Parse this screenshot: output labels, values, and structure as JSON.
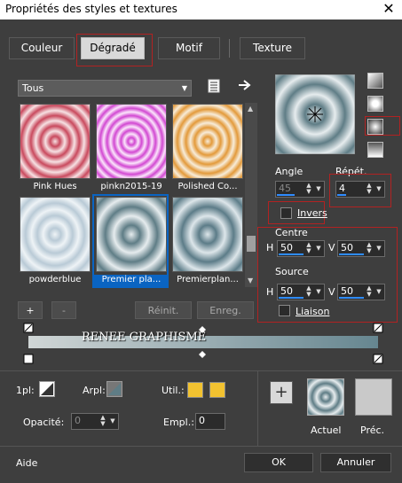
{
  "window": {
    "title": "Propriétés des styles et textures",
    "close_label": "✕"
  },
  "tabs": [
    {
      "label": "Couleur",
      "active": false
    },
    {
      "label": "Dégradé",
      "active": true
    },
    {
      "label": "Motif",
      "active": false
    },
    {
      "label": "Texture",
      "active": false
    }
  ],
  "category_dropdown": {
    "value": "Tous"
  },
  "gradients": [
    {
      "label": "Pink Hues"
    },
    {
      "label": "pinkn2015-19"
    },
    {
      "label": "Polished Co..."
    },
    {
      "label": "powderblue"
    },
    {
      "label": "Premier pla...",
      "selected": true
    },
    {
      "label": "Premierplan..."
    }
  ],
  "list_buttons": {
    "add": "+",
    "remove": "-",
    "reset": "Réinit.",
    "save": "Enreg."
  },
  "gradient_bar": {
    "watermark": "RENEE GRAPHISME"
  },
  "angle": {
    "label": "Angle",
    "value": "45"
  },
  "repeat": {
    "label": "Répét.",
    "value": "4"
  },
  "invert": {
    "label": "Invers",
    "checked": false
  },
  "center": {
    "label": "Centre",
    "h_label": "H",
    "h_value": "50",
    "v_label": "V",
    "v_value": "50"
  },
  "source": {
    "label": "Source",
    "h_label": "H",
    "h_value": "50",
    "v_label": "V",
    "v_value": "50"
  },
  "link": {
    "label": "Liaison",
    "checked": false
  },
  "stops": {
    "first_label": "1pl:",
    "bg_label": "Arpl:",
    "user_label": "Util.:",
    "opacity_label": "Opacité:",
    "opacity_value": "0",
    "location_label": "Empl.:",
    "location_value": "0"
  },
  "preview": {
    "add_label": "+",
    "current_label": "Actuel",
    "previous_label": "Préc."
  },
  "footer": {
    "help": "Aide",
    "ok": "OK",
    "cancel": "Annuler"
  },
  "colors": {
    "panel": "#3e3e3e",
    "accent_blue": "#0a64c2",
    "highlight_red": "#b22222",
    "user_color": "#f2c230",
    "gradient_light": "#e6ecee",
    "gradient_dark": "#5f7d86",
    "previous_color": "#c9c9c9"
  }
}
